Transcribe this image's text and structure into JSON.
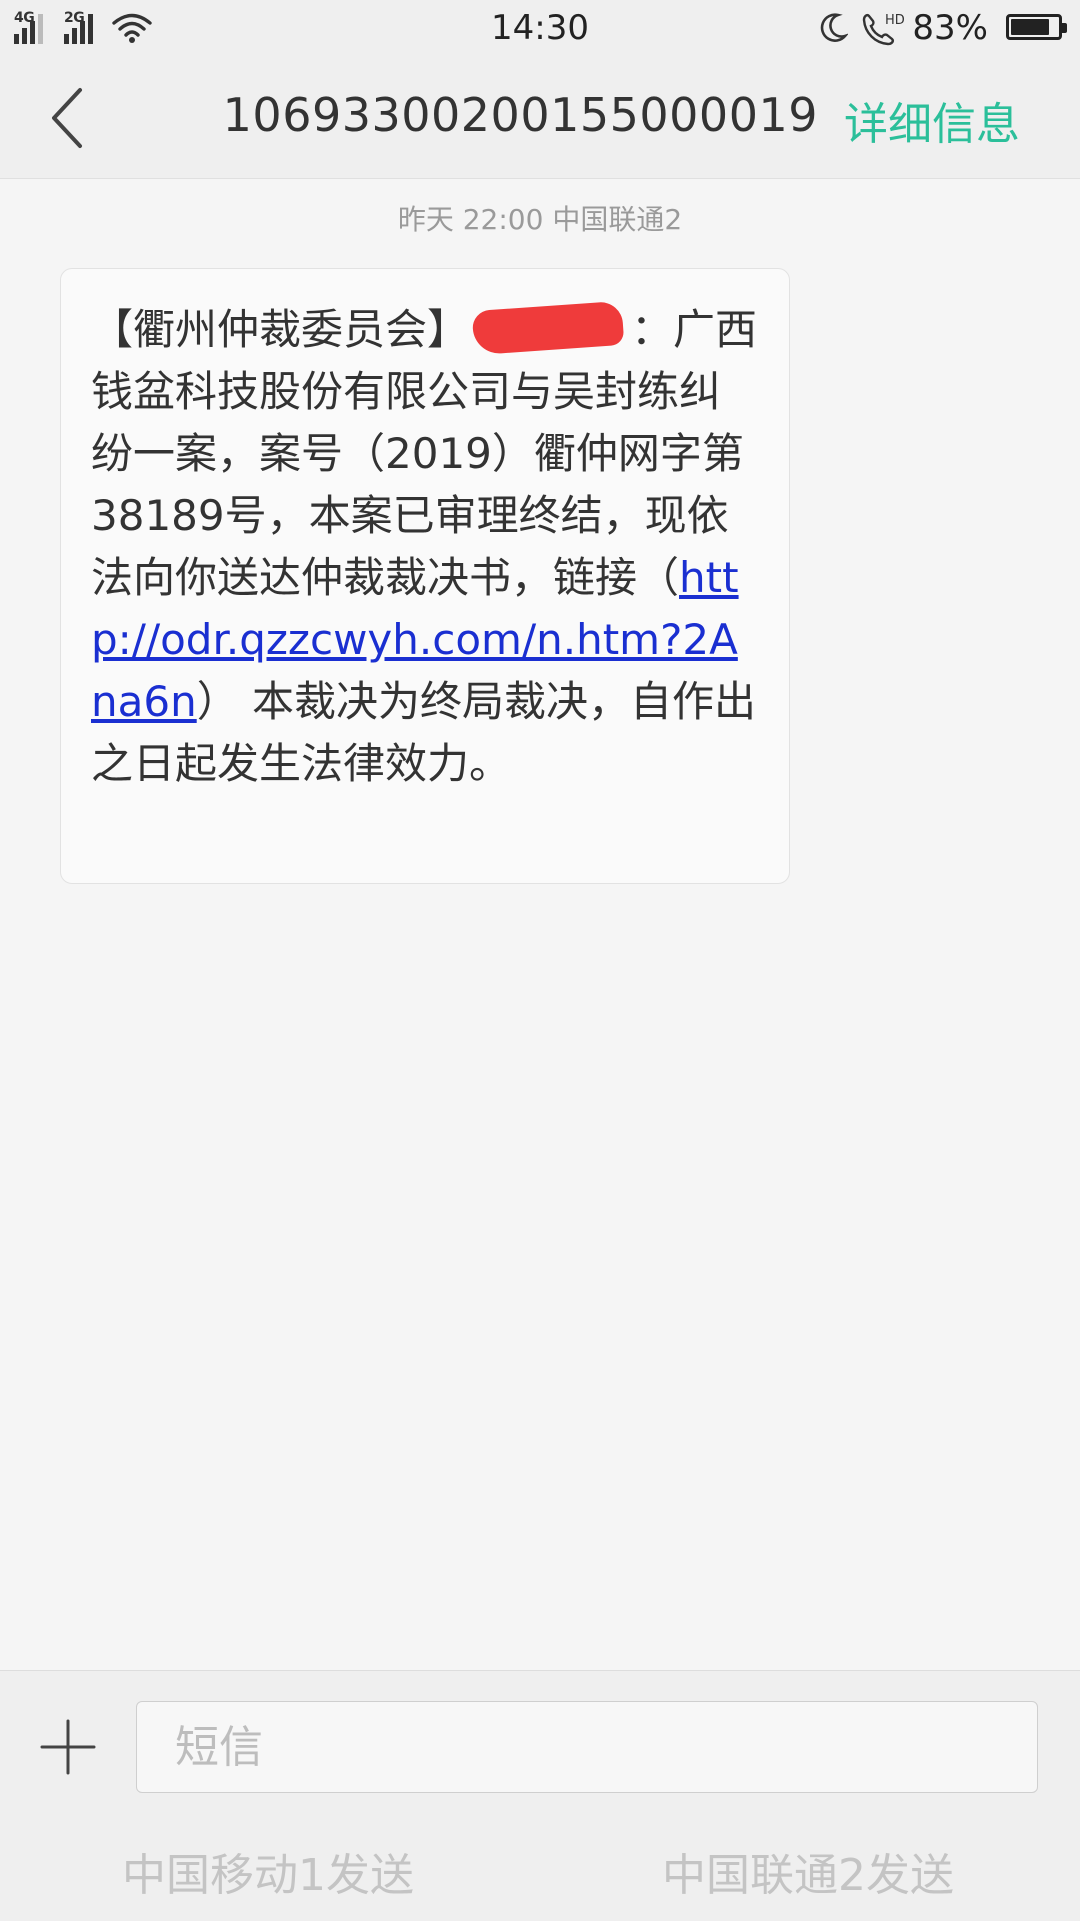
{
  "status_bar": {
    "sim1_label": "4G",
    "sim2_label": "2G",
    "time": "14:30",
    "battery_percent": "83%",
    "battery_level": 0.83,
    "icons": [
      "signal-icon",
      "wifi-icon",
      "moon-icon",
      "hd-call-icon",
      "battery-icon"
    ]
  },
  "header": {
    "sender_number": "10693300200155000019",
    "detail_label": "详细信息",
    "detail_color": "#2bbf9a"
  },
  "conversation": {
    "meta_line": "昨天  22:00  中国联通2",
    "message": {
      "prefix": "【衢州仲裁委员会】",
      "after_redaction": "：广西钱盆科技股份有限公司与吴封练纠纷一案，案号（2019）衢仲网字第38189号，本案已审理终结，现依法向你送达仲裁裁决书，链接（",
      "link": "http://odr.qzzcwyh.com/n.htm?2Ana6n",
      "suffix": "） 本裁决为终局裁决，自作出之日起发生法律效力。",
      "link_color": "#1a2fd1",
      "redaction_color": "#ef3b3b"
    }
  },
  "composer": {
    "placeholder": "短信",
    "send_sim1_label": "中国移动1发送",
    "send_sim2_label": "中国联通2发送"
  }
}
